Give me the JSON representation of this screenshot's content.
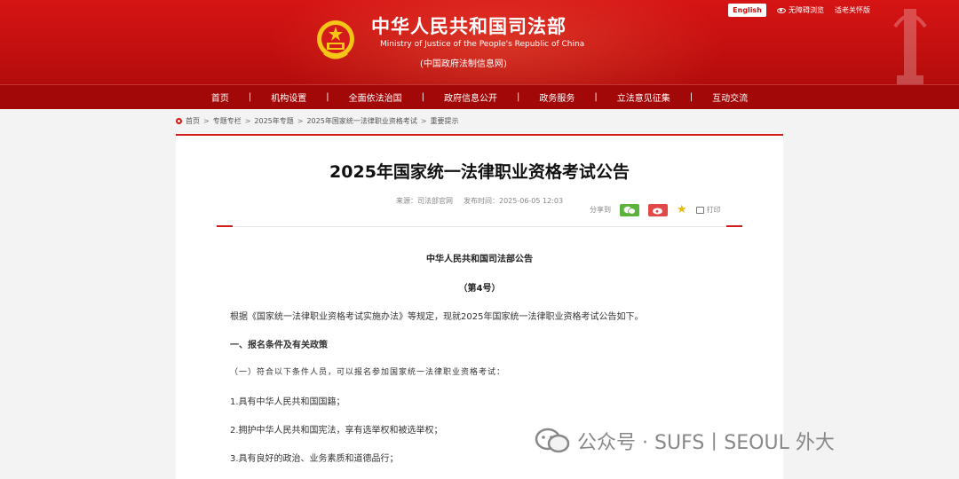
{
  "header": {
    "title": "中华人民共和国司法部",
    "subtitle": "Ministry of Justice of the People's Republic of China",
    "tag": "(中国政府法制信息网)",
    "english_label": "English",
    "accessibility_label": "无障碍浏览",
    "elderly_label": "适老关怀版"
  },
  "nav": {
    "items": [
      "首页",
      "机构设置",
      "全面依法治国",
      "政府信息公开",
      "政务服务",
      "立法意见征集",
      "互动交流"
    ]
  },
  "breadcrumb": [
    "首页",
    "专题专栏",
    "2025年专题",
    "2025年国家统一法律职业资格考试",
    "重要提示"
  ],
  "article": {
    "title": "2025年国家统一法律职业资格考试公告",
    "source": "来源：司法部官网",
    "published": "发布时间：2025-06-05 12:03",
    "share_label": "分享到",
    "print_label": "打印",
    "notice_title": "中华人民共和国司法部公告",
    "notice_number": "（第4号）",
    "intro": "根据《国家统一法律职业资格考试实施办法》等规定，现就2025年国家统一法律职业资格考试公告如下。",
    "section1": "一、报名条件及有关政策",
    "sub1": "（一）符合以下条件人员，可以报名参加国家统一法律职业资格考试：",
    "item1": "1.具有中华人民共和国国籍；",
    "item2": "2.拥护中华人民共和国宪法，享有选举权和被选举权；",
    "item3": "3.具有良好的政治、业务素质和道德品行；"
  },
  "watermark": {
    "text": "公众号 · SUFS丨SEOUL 外大"
  },
  "colors": {
    "brand_red": "#c20f0f",
    "nav_red": "#a30808"
  }
}
